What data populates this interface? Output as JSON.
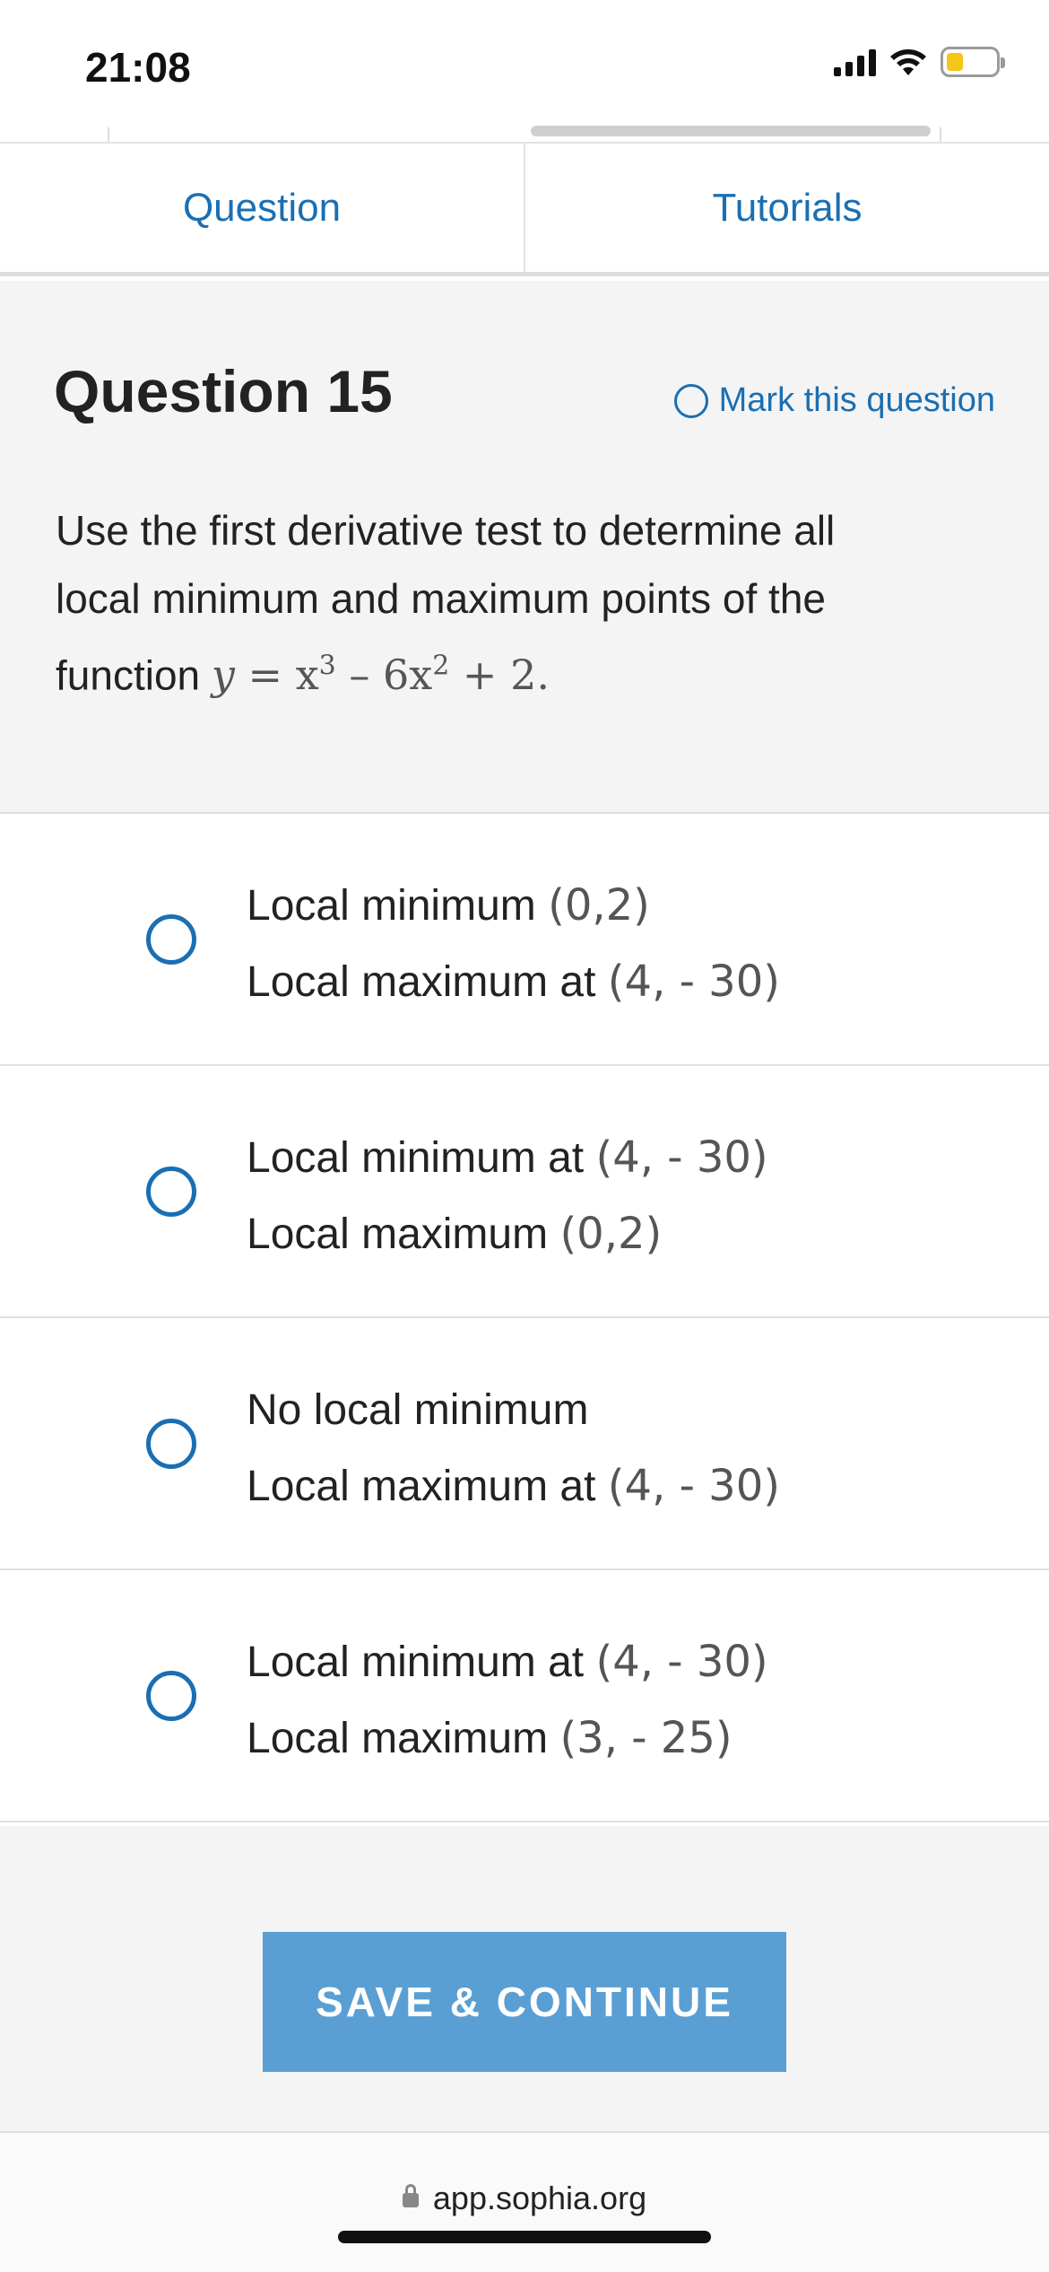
{
  "status": {
    "time": "21:08"
  },
  "tabs": [
    {
      "label": "Question"
    },
    {
      "label": "Tutorials"
    }
  ],
  "question": {
    "title": "Question 15",
    "mark_label": "Mark this question",
    "text_line1": "Use the first derivative test to determine all",
    "text_line2": "local minimum and maximum points of the",
    "text_line3_prefix": "function ",
    "math_y": "y",
    "math_eq": " = x",
    "math_exp1": "3",
    "math_mid": " – 6x",
    "math_exp2": "2",
    "math_end": " + 2.",
    "period": ""
  },
  "options": [
    {
      "line1_label": "Local minimum ",
      "line1_coord": "(0,2)",
      "line2_label": "Local maximum at ",
      "line2_coord": "(4, - 30)"
    },
    {
      "line1_label": "Local minimum at ",
      "line1_coord": "(4, - 30)",
      "line2_label": "Local maximum ",
      "line2_coord": "(0,2)"
    },
    {
      "line1_label": "No local minimum",
      "line1_coord": "",
      "line2_label": "Local maximum at ",
      "line2_coord": "(4, - 30)"
    },
    {
      "line1_label": "Local minimum at ",
      "line1_coord": "(4, - 30)",
      "line2_label": "Local maximum ",
      "line2_coord": "(3, - 25)"
    }
  ],
  "actions": {
    "save_label": "SAVE & CONTINUE"
  },
  "browser": {
    "url": "app.sophia.org"
  },
  "colors": {
    "accent": "#1a6fb3",
    "button": "#5a9fd4",
    "panel": "#f4f4f4"
  },
  "icons": {
    "signal": "cellular-signal-icon",
    "wifi": "wifi-icon",
    "battery": "battery-icon",
    "lock": "lock-icon"
  }
}
